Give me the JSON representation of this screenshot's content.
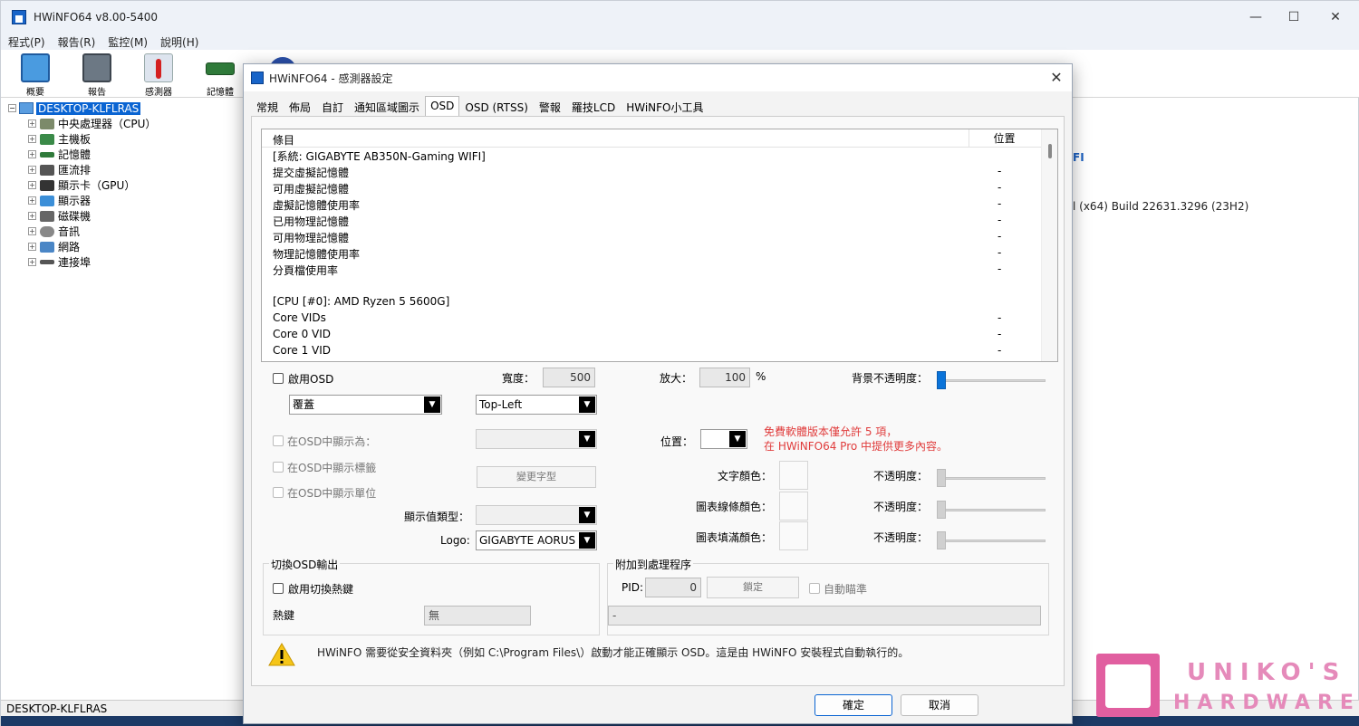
{
  "main": {
    "title": "HWiNFO64 v8.00-5400",
    "menu": [
      "程式(P)",
      "報告(R)",
      "監控(M)",
      "說明(H)"
    ],
    "toolbar": [
      "概要",
      "報告",
      "感測器",
      "記憶體"
    ],
    "tree_root": "DESKTOP-KLFLRAS",
    "tree_items": [
      "中央處理器（CPU）",
      "主機板",
      "記憶體",
      "匯流排",
      "顯示卡（GPU）",
      "顯示器",
      "磁碟機",
      "音訊",
      "網路",
      "連接埠"
    ],
    "right_text_1": "FI",
    "right_text_2": "l (x64) Build 22631.3296 (23H2)",
    "status": "DESKTOP-KLFLRAS"
  },
  "dialog": {
    "title": "HWiNFO64 - 感測器設定",
    "close": "✕",
    "tabs": [
      "常規",
      "佈局",
      "自訂",
      "通知區域圖示",
      "OSD",
      "OSD (RTSS)",
      "警報",
      "羅技LCD",
      "HWiNFO小工具"
    ],
    "selected_tab": "OSD",
    "list": {
      "col_item": "條目",
      "col_pos": "位置",
      "rows": [
        {
          "name": "[系統: GIGABYTE AB350N-Gaming WIFI]",
          "pos": ""
        },
        {
          "name": "提交虛擬記憶體",
          "pos": "-"
        },
        {
          "name": "可用虛擬記憶體",
          "pos": "-"
        },
        {
          "name": "虛擬記憶體使用率",
          "pos": "-"
        },
        {
          "name": "已用物理記憶體",
          "pos": "-"
        },
        {
          "name": "可用物理記憶體",
          "pos": "-"
        },
        {
          "name": "物理記憶體使用率",
          "pos": "-"
        },
        {
          "name": "分頁檔使用率",
          "pos": "-"
        },
        {
          "name": "",
          "pos": ""
        },
        {
          "name": "[CPU [#0]: AMD Ryzen 5 5600G]",
          "pos": ""
        },
        {
          "name": "Core VIDs",
          "pos": "-"
        },
        {
          "name": "Core 0 VID",
          "pos": "-"
        },
        {
          "name": "Core 1 VID",
          "pos": "-"
        }
      ]
    },
    "enable_osd": "啟用OSD",
    "mode": "覆蓋",
    "width_label": "寬度：",
    "width_value": "500",
    "anchor": "Top-Left",
    "zoom_label": "放大：",
    "zoom_value": "100",
    "zoom_unit": "%",
    "bg_opacity_label": "背景不透明度：",
    "show_as_label": "在OSD中顯示為：",
    "show_label_label": "在OSD中顯示標籤",
    "show_unit_label": "在OSD中顯示單位",
    "change_font": "變更字型",
    "position_label": "位置：",
    "free_note_1": "免費軟體版本僅允許 5 項，",
    "free_note_2": "在 HWiNFO64 Pro 中提供更多內容。",
    "text_color_label": "文字顏色：",
    "line_color_label": "圖表線條顏色：",
    "fill_color_label": "圖表填滿顏色：",
    "opacity_label": "不透明度：",
    "value_type_label": "顯示值類型：",
    "logo_label": "Logo:",
    "logo_value": "GIGABYTE AORUS",
    "toggle_group": "切換OSD輸出",
    "enable_hotkey": "啟用切換熱鍵",
    "hotkey_label": "熱鍵",
    "hotkey_value": "無",
    "attach_group": "附加到處理程序",
    "pid_label": "PID:",
    "pid_value": "0",
    "lock_btn": "鎖定",
    "auto_aim": "自動瞄準",
    "process_value": "-",
    "warning": "HWiNFO 需要從安全資料夾（例如 C:\\Program Files\\）啟動才能正確顯示 OSD。這是由 HWiNFO 安裝程式自動執行的。",
    "ok": "確定",
    "cancel": "取消"
  },
  "watermark": {
    "line1": "UNIKO'S",
    "line2": "HARDWARE"
  },
  "colors": {
    "accent": "#0a64d2",
    "note": "#e03c3c",
    "watermark": "#e58aba"
  }
}
